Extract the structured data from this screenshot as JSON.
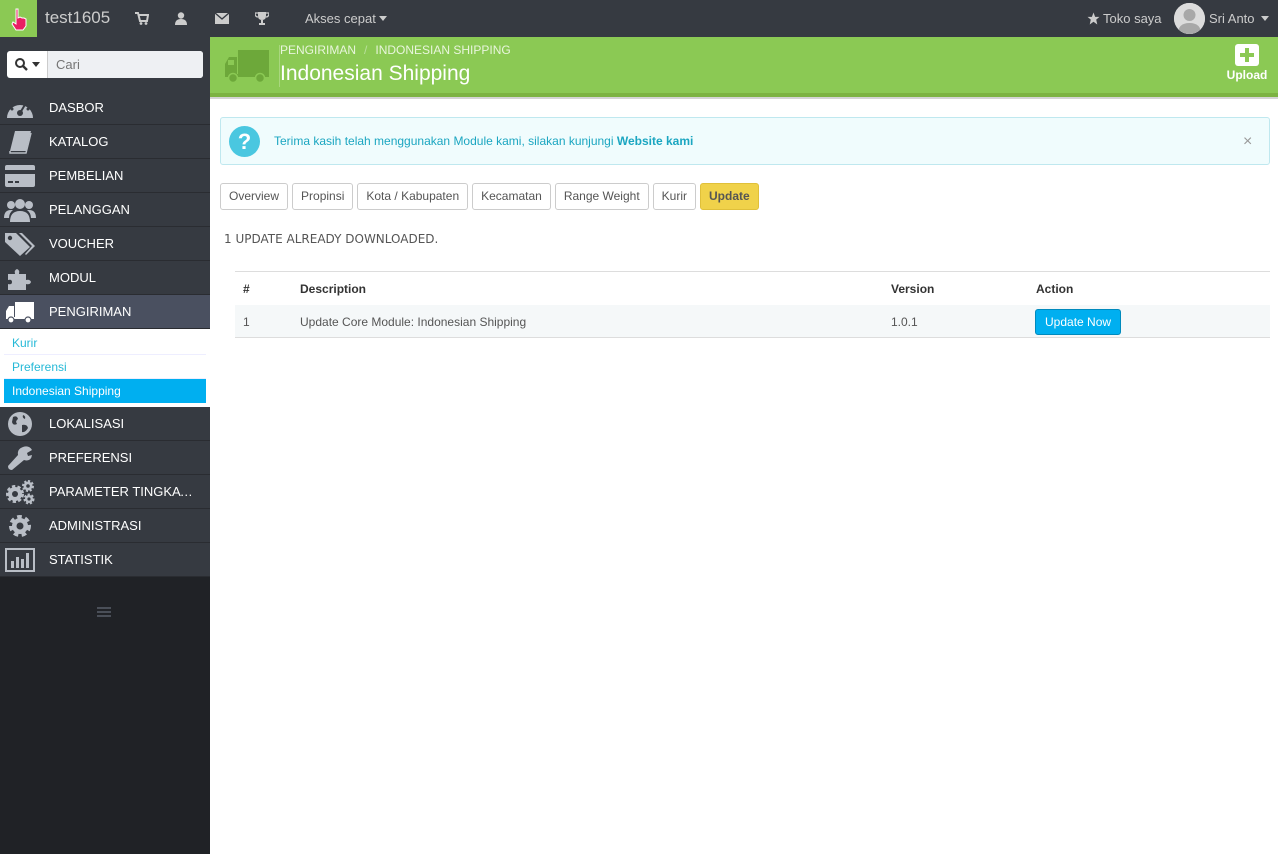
{
  "topbar": {
    "shop_name": "test1605",
    "quick_access": "Akses cepat",
    "my_shop": "Toko saya",
    "user_name": "Sri Anto"
  },
  "sidebar": {
    "search_placeholder": "Cari",
    "items": [
      {
        "label": "DASBOR",
        "icon": "dashboard-icon"
      },
      {
        "label": "KATALOG",
        "icon": "book-icon"
      },
      {
        "label": "PEMBELIAN",
        "icon": "credit-card-icon"
      },
      {
        "label": "PELANGGAN",
        "icon": "users-icon"
      },
      {
        "label": "VOUCHER",
        "icon": "tags-icon"
      },
      {
        "label": "MODUL",
        "icon": "puzzle-icon"
      },
      {
        "label": "PENGIRIMAN",
        "icon": "truck-icon"
      },
      {
        "label": "LOKALISASI",
        "icon": "globe-icon"
      },
      {
        "label": "PREFERENSI",
        "icon": "wrench-icon"
      },
      {
        "label": "PARAMETER TINGKAT LA...",
        "icon": "cogs-icon"
      },
      {
        "label": "ADMINISTRASI",
        "icon": "gear-icon"
      },
      {
        "label": "STATISTIK",
        "icon": "bar-chart-icon"
      }
    ],
    "submenu": [
      "Kurir",
      "Preferensi",
      "Indonesian Shipping"
    ]
  },
  "header": {
    "breadcrumb_1": "PENGIRIMAN",
    "breadcrumb_2": "INDONESIAN SHIPPING",
    "title": "Indonesian Shipping",
    "upload_label": "Upload"
  },
  "alert": {
    "text": "Terima kasih telah menggunakan Module kami, silakan kunjungi ",
    "link": "Website kami",
    "close": "×"
  },
  "tabs": [
    "Overview",
    "Propinsi",
    "Kota / Kabupaten",
    "Kecamatan",
    "Range Weight",
    "Kurir",
    "Update"
  ],
  "section_title": "1 UPDATE ALREADY DOWNLOADED.",
  "table": {
    "headers": [
      "#",
      "Description",
      "Version",
      "Action"
    ],
    "rows": [
      {
        "num": "1",
        "description": "Update Core Module: Indonesian Shipping",
        "version": "1.0.1",
        "action": "Update Now"
      }
    ]
  },
  "colors": {
    "header_green": "#8bc954",
    "active_tab": "#f0d24a",
    "primary_blue": "#00aff0",
    "sidebar_dark": "#363a41"
  }
}
